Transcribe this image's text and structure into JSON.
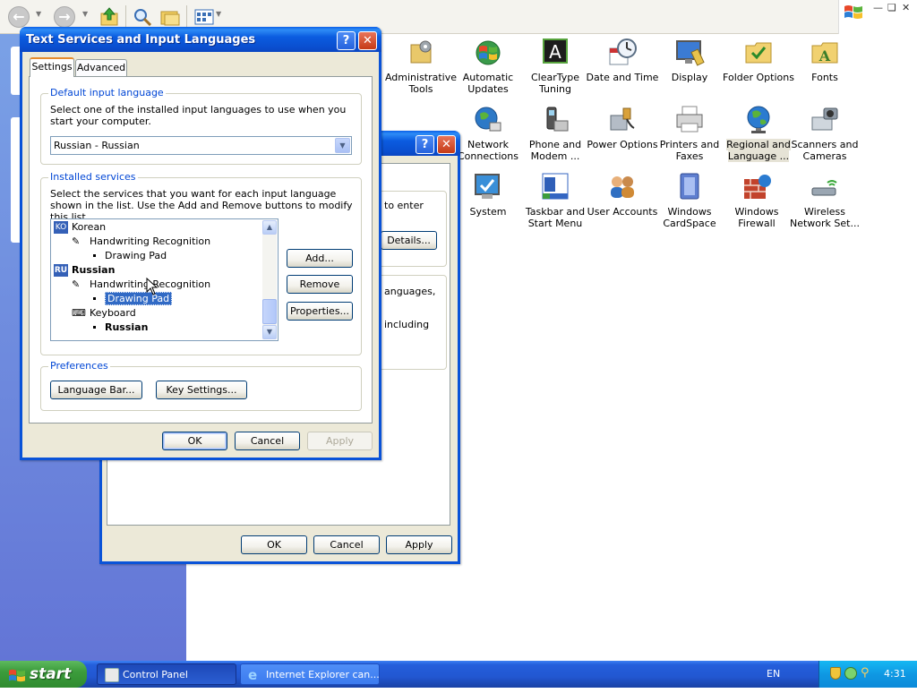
{
  "control_panel": {
    "toolbar_icons": [
      "back-icon",
      "forward-icon",
      "up-folder-icon",
      "search-icon",
      "folders-icon",
      "views-icon"
    ],
    "items": [
      {
        "label": "Administrative Tools",
        "icon": "admin-tools-icon",
        "color": "#8a8a8a"
      },
      {
        "label": "Automatic Updates",
        "icon": "automatic-updates-icon",
        "color": "#2f8f3e"
      },
      {
        "label": "ClearType Tuning",
        "icon": "cleartype-icon",
        "color": "#2a2a2a"
      },
      {
        "label": "Date and Time",
        "icon": "clock-icon",
        "color": "#c9c9c9"
      },
      {
        "label": "Display",
        "icon": "display-icon",
        "color": "#3b7bd4"
      },
      {
        "label": "Folder Options",
        "icon": "folder-options-icon",
        "color": "#e7c25a"
      },
      {
        "label": "Fonts",
        "icon": "fonts-folder-icon",
        "color": "#e8c24c"
      },
      {
        "label": "Network Connections",
        "icon": "network-globe-icon",
        "color": "#2d79c7"
      },
      {
        "label": "Phone and Modem ...",
        "icon": "phone-icon",
        "color": "#555555"
      },
      {
        "label": "Power Options",
        "icon": "power-icon",
        "color": "#9aa0aa"
      },
      {
        "label": "Printers and Faxes",
        "icon": "printer-icon",
        "color": "#c7c7c7"
      },
      {
        "label": "Regional and Language ...",
        "icon": "globe-icon",
        "color": "#2b7bd0"
      },
      {
        "label": "Scanners and Cameras",
        "icon": "scanner-camera-icon",
        "color": "#8f9aa6"
      },
      {
        "label": "System",
        "icon": "system-icon",
        "color": "#3a8fd8"
      },
      {
        "label": "Taskbar and Start Menu",
        "icon": "taskbar-icon",
        "color": "#3466c2"
      },
      {
        "label": "User Accounts",
        "icon": "user-accounts-icon",
        "color": "#d08a36"
      },
      {
        "label": "Windows CardSpace",
        "icon": "cardspace-icon",
        "color": "#5f7fd0"
      },
      {
        "label": "Windows Firewall",
        "icon": "firewall-icon",
        "color": "#c2432c"
      },
      {
        "label": "Wireless Network Set...",
        "icon": "wireless-icon",
        "color": "#6c7a86"
      }
    ]
  },
  "regional_dialog": {
    "help_label": "?",
    "close_label": "✕",
    "partial_text_1": "to enter",
    "details_button": "Details...",
    "partial_text_2": "anguages,",
    "partial_text_3": "including",
    "ok": "OK",
    "cancel": "Cancel",
    "apply": "Apply"
  },
  "text_services_dialog": {
    "title": "Text Services and Input Languages",
    "help_label": "?",
    "close_label": "✕",
    "tabs": [
      "Settings",
      "Advanced"
    ],
    "default_group": {
      "legend": "Default input language",
      "description": "Select one of the installed input languages to use when you start your computer.",
      "selected_language": "Russian - Russian"
    },
    "installed_group": {
      "legend": "Installed services",
      "description": "Select the services that you want for each input language shown in the list. Use the Add and Remove buttons to modify this list.",
      "tree": {
        "korean_badge": "KO",
        "korean": "Korean",
        "korean_hw": "Handwriting Recognition",
        "korean_pad": "Drawing Pad",
        "russian_badge": "RU",
        "russian": "Russian",
        "russian_hw": "Handwriting Recognition",
        "russian_pad": "Drawing Pad",
        "keyboard": "Keyboard",
        "keyboard_layout": "Russian"
      },
      "add": "Add...",
      "remove": "Remove",
      "properties": "Properties..."
    },
    "preferences_group": {
      "legend": "Preferences",
      "language_bar": "Language Bar...",
      "key_settings": "Key Settings..."
    },
    "ok": "OK",
    "cancel": "Cancel",
    "apply": "Apply"
  },
  "taskbar": {
    "start": "start",
    "tasks": [
      {
        "label": "Control Panel",
        "active": true
      },
      {
        "label": "Internet Explorer can...",
        "active": false
      }
    ],
    "language_indicator": "EN",
    "clock": "4:31"
  }
}
